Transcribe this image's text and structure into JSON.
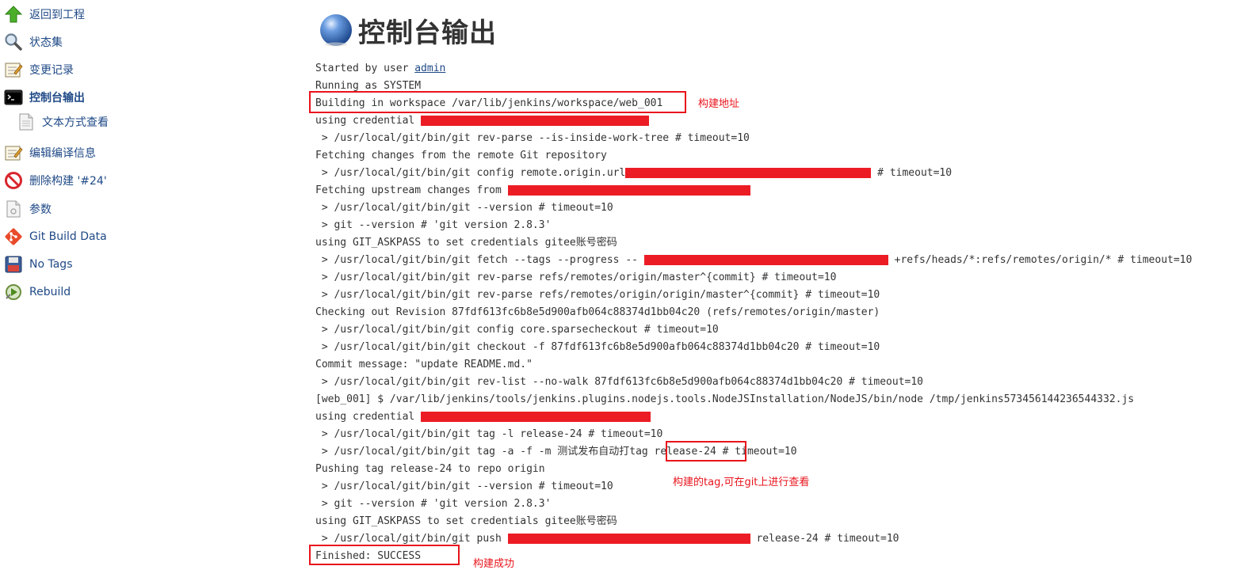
{
  "sidebar": {
    "items": [
      {
        "label": "返回到工程",
        "icon": "up-arrow-icon"
      },
      {
        "label": "状态集",
        "icon": "magnifier-icon"
      },
      {
        "label": "变更记录",
        "icon": "notepad-icon"
      },
      {
        "label": "控制台输出",
        "icon": "terminal-icon",
        "active": true
      },
      {
        "label": "文本方式查看",
        "icon": "document-icon"
      },
      {
        "label": "编辑编译信息",
        "icon": "notepad-icon"
      },
      {
        "label": "删除构建 '#24'",
        "icon": "no-entry-icon"
      },
      {
        "label": "参数",
        "icon": "document-icon"
      },
      {
        "label": "Git Build Data",
        "icon": "git-icon"
      },
      {
        "label": "No Tags",
        "icon": "floppy-disk-icon"
      },
      {
        "label": "Rebuild",
        "icon": "rebuild-icon"
      }
    ]
  },
  "page": {
    "title": "控制台输出"
  },
  "console": {
    "user_link": "admin",
    "lines": {
      "l0_prefix": "Started by user ",
      "l1": "Running as SYSTEM",
      "l2": "Building in workspace /var/lib/jenkins/workspace/web_001",
      "l3": "using credential ",
      "l4": " > /usr/local/git/bin/git rev-parse --is-inside-work-tree # timeout=10",
      "l5": "Fetching changes from the remote Git repository",
      "l6a": " > /usr/local/git/bin/git config remote.origin.url",
      "l6b": " # timeout=10",
      "l7": "Fetching upstream changes from ",
      "l8": " > /usr/local/git/bin/git --version # timeout=10",
      "l9": " > git --version # 'git version 2.8.3'",
      "l10": "using GIT_ASKPASS to set credentials gitee账号密码",
      "l11a": " > /usr/local/git/bin/git fetch --tags --progress -- ",
      "l11b": " +refs/heads/*:refs/remotes/origin/* # timeout=10",
      "l12": " > /usr/local/git/bin/git rev-parse refs/remotes/origin/master^{commit} # timeout=10",
      "l13": " > /usr/local/git/bin/git rev-parse refs/remotes/origin/origin/master^{commit} # timeout=10",
      "l14": "Checking out Revision 87fdf613fc6b8e5d900afb064c88374d1bb04c20 (refs/remotes/origin/master)",
      "l15": " > /usr/local/git/bin/git config core.sparsecheckout # timeout=10",
      "l16": " > /usr/local/git/bin/git checkout -f 87fdf613fc6b8e5d900afb064c88374d1bb04c20 # timeout=10",
      "l17": "Commit message: \"update README.md.\"",
      "l18": " > /usr/local/git/bin/git rev-list --no-walk 87fdf613fc6b8e5d900afb064c88374d1bb04c20 # timeout=10",
      "l19": "[web_001] $ /var/lib/jenkins/tools/jenkins.plugins.nodejs.tools.NodeJSInstallation/NodeJS/bin/node /tmp/jenkins573456144236544332.js",
      "l20": "using credential ",
      "l21": " > /usr/local/git/bin/git tag -l release-24 # timeout=10",
      "l22a": " > /usr/local/git/bin/git tag -a -f -m 测试发布自动打tag ",
      "l22b": "release-24",
      "l22c": " # timeout=10",
      "l23": "Pushing tag release-24 to repo origin",
      "l24": " > /usr/local/git/bin/git --version # timeout=10",
      "l25": " > git --version # 'git version 2.8.3'",
      "l26": "using GIT_ASKPASS to set credentials gitee账号密码",
      "l27a": " > /usr/local/git/bin/git push ",
      "l27b": " release-24 # timeout=10",
      "l28": "Finished: SUCCESS"
    }
  },
  "annotations": {
    "workspace_note": "构建地址",
    "tag_note": "构建的tag,可在git上进行查看",
    "success_note": "构建成功"
  },
  "colors": {
    "annotation_red": "#e8141c",
    "redaction_red": "#ec1c24",
    "link_blue": "#204a87"
  }
}
